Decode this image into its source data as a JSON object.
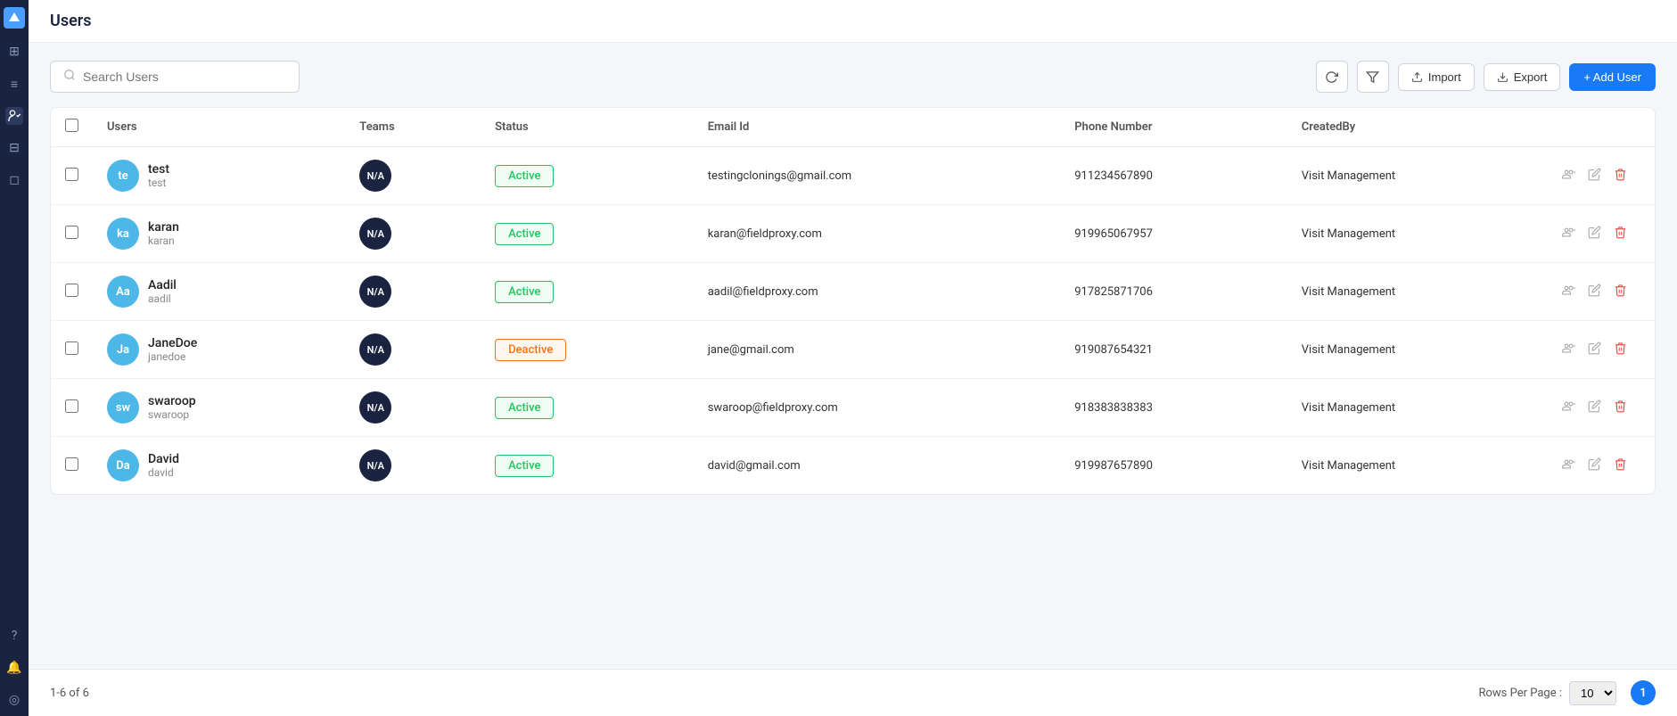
{
  "page": {
    "title": "Users"
  },
  "search": {
    "placeholder": "Search Users"
  },
  "toolbar": {
    "refresh_label": "↻",
    "filter_label": "⊟",
    "import_label": "Import",
    "export_label": "Export",
    "add_user_label": "+ Add User"
  },
  "table": {
    "columns": [
      "",
      "Users",
      "Teams",
      "Status",
      "Email Id",
      "Phone Number",
      "CreatedBy",
      ""
    ],
    "rows": [
      {
        "id": "1",
        "avatar_initials": "te",
        "avatar_color": "#4db8e8",
        "name": "test",
        "username": "test",
        "team": "N/A",
        "status": "Active",
        "status_type": "active",
        "email": "testingclonings@gmail.com",
        "phone": "911234567890",
        "created_by": "Visit Management"
      },
      {
        "id": "2",
        "avatar_initials": "ka",
        "avatar_color": "#4db8e8",
        "name": "karan",
        "username": "karan",
        "team": "N/A",
        "status": "Active",
        "status_type": "active",
        "email": "karan@fieldproxy.com",
        "phone": "919965067957",
        "created_by": "Visit Management"
      },
      {
        "id": "3",
        "avatar_initials": "Aa",
        "avatar_color": "#4db8e8",
        "name": "Aadil",
        "username": "aadil",
        "team": "N/A",
        "status": "Active",
        "status_type": "active",
        "email": "aadil@fieldproxy.com",
        "phone": "917825871706",
        "created_by": "Visit Management"
      },
      {
        "id": "4",
        "avatar_initials": "Ja",
        "avatar_color": "#4db8e8",
        "name": "JaneDoe",
        "username": "janedoe",
        "team": "N/A",
        "status": "Deactive",
        "status_type": "deactive",
        "email": "jane@gmail.com",
        "phone": "919087654321",
        "created_by": "Visit Management"
      },
      {
        "id": "5",
        "avatar_initials": "sw",
        "avatar_color": "#4db8e8",
        "name": "swaroop",
        "username": "swaroop",
        "team": "N/A",
        "status": "Active",
        "status_type": "active",
        "email": "swaroop@fieldproxy.com",
        "phone": "918383838383",
        "created_by": "Visit Management"
      },
      {
        "id": "6",
        "avatar_initials": "Da",
        "avatar_color": "#4db8e8",
        "name": "David",
        "username": "david",
        "team": "N/A",
        "status": "Active",
        "status_type": "active",
        "email": "david@gmail.com",
        "phone": "919987657890",
        "created_by": "Visit Management"
      }
    ]
  },
  "footer": {
    "pagination_info": "1-6 of 6",
    "rows_per_page_label": "Rows Per Page :",
    "rows_per_page_value": "10",
    "current_page": "1"
  },
  "sidebar": {
    "icons": [
      "◈",
      "⊞",
      "≡",
      "◉",
      "⊟",
      "◻",
      "?",
      "🔔",
      "◎"
    ]
  }
}
